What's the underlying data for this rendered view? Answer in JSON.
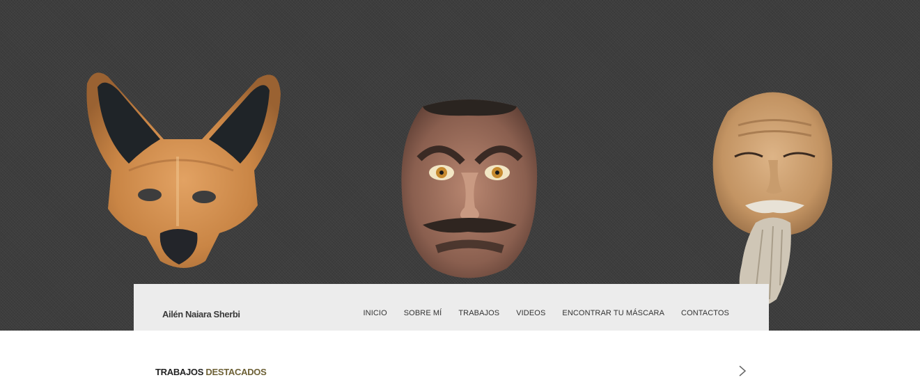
{
  "hero": {
    "masks": [
      {
        "name": "fox-mask"
      },
      {
        "name": "oni-mask"
      },
      {
        "name": "elder-mask"
      }
    ]
  },
  "navbar": {
    "brand": "Ailén Naiara Sherbi",
    "items": [
      "INICIO",
      "SOBRE MÍ",
      "TRABAJOS",
      "VIDEOS",
      "ENCONTRAR TU MÁSCARA",
      "CONTACTOS"
    ]
  },
  "featured": {
    "title_part1": "TRABAJOS",
    "title_part2": "DESTACADOS",
    "next_icon": "chevron-right-icon"
  },
  "colors": {
    "hero_bg": "#3d3d3d",
    "navbar_bg": "#ececec",
    "accent": "#6d6035"
  }
}
